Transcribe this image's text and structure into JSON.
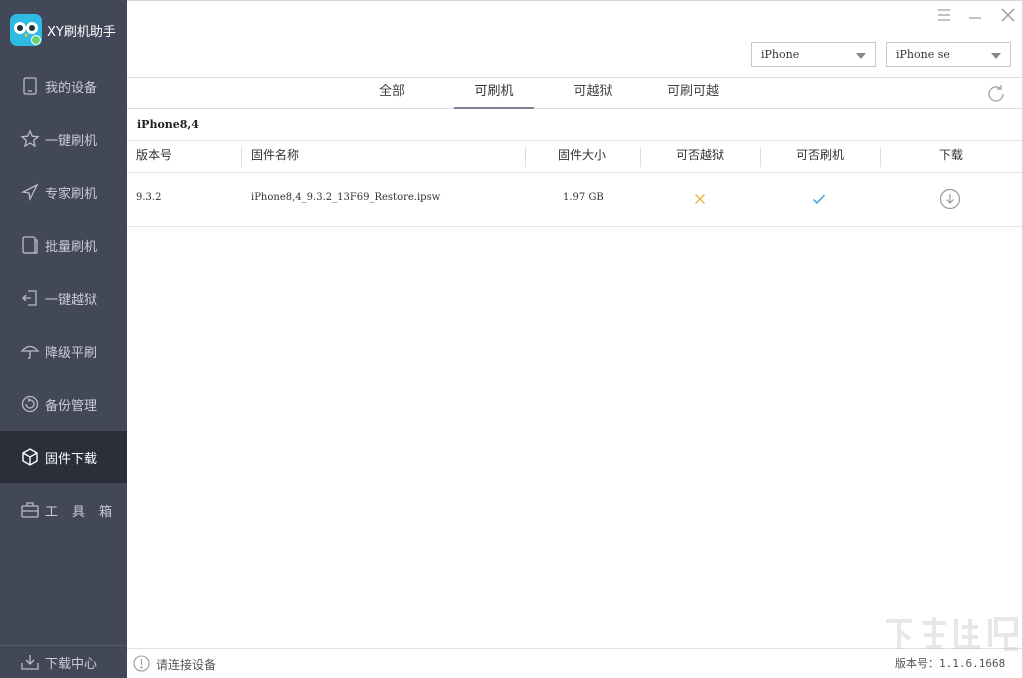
{
  "app": {
    "title": "XY刷机助手"
  },
  "sidebar": {
    "items": [
      {
        "label": "我的设备",
        "icon": "phone-icon"
      },
      {
        "label": "一键刷机",
        "icon": "star-icon"
      },
      {
        "label": "专家刷机",
        "icon": "paper-plane-icon"
      },
      {
        "label": "批量刷机",
        "icon": "tablet-icon"
      },
      {
        "label": "一键越狱",
        "icon": "exit-icon"
      },
      {
        "label": "降级平刷",
        "icon": "umbrella-icon"
      },
      {
        "label": "备份管理",
        "icon": "backup-icon"
      },
      {
        "label": "固件下载",
        "icon": "cube-icon",
        "active": true
      },
      {
        "label": "工具箱",
        "icon": "toolbox-icon"
      }
    ],
    "footer": {
      "label": "下载中心",
      "icon": "download-tray-icon"
    }
  },
  "selects": {
    "device_type": "iPhone",
    "device_model": "iPhone se"
  },
  "tabs": [
    {
      "label": "全部"
    },
    {
      "label": "可刷机",
      "active": true
    },
    {
      "label": "可越狱"
    },
    {
      "label": "可刷可越"
    }
  ],
  "device_title": "iPhone8,4",
  "table": {
    "headers": {
      "version": "版本号",
      "name": "固件名称",
      "size": "固件大小",
      "jailbreak": "可否越狱",
      "flash": "可否刷机",
      "download": "下载"
    },
    "rows": [
      {
        "version": "9.3.2",
        "name": "iPhone8,4_9.3.2_13F69_Restore.ipsw",
        "size": "1.97 GB",
        "jailbreak": "no",
        "flash": "yes"
      }
    ]
  },
  "status": {
    "text": "请连接设备",
    "version": "版本号：1.1.6.1668"
  },
  "colors": {
    "sidebar_bg": "#434859",
    "sidebar_active": "#2b2f3a",
    "cross": "#e8b84a",
    "check": "#4aa3df"
  }
}
